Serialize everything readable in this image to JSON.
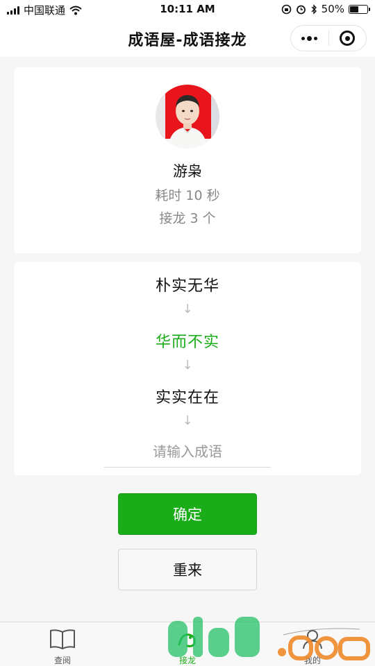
{
  "status_bar": {
    "carrier": "中国联通",
    "time": "10:11 AM",
    "battery_text": "50%",
    "battery_level": 0.5
  },
  "nav": {
    "title": "成语屋-成语接龙"
  },
  "profile": {
    "nickname": "游枭",
    "time_text": "耗时 10 秒",
    "count_text": "接龙 3 个"
  },
  "chain": {
    "idioms": [
      "朴实无华",
      "华而不实",
      "实实在在"
    ],
    "arrow": "↓",
    "input_placeholder": "请输入成语",
    "input_value": ""
  },
  "buttons": {
    "confirm": "确定",
    "restart": "重来"
  },
  "tabs": [
    {
      "label": "查阅",
      "icon": "book-icon"
    },
    {
      "label": "接龙",
      "icon": "dragon-icon"
    },
    {
      "label": "我的",
      "icon": "user-icon"
    }
  ],
  "colors": {
    "accent": "#1aad19",
    "muted_text": "#888888",
    "background": "#f6f6f6"
  }
}
